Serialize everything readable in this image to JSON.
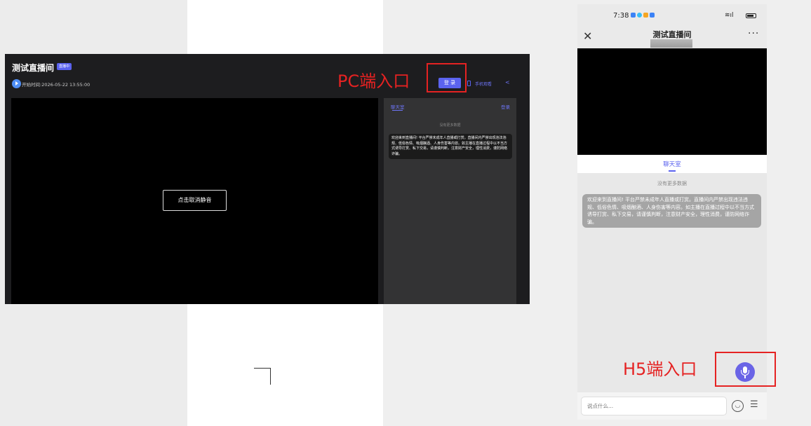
{
  "pc": {
    "title": "测试直播间",
    "live_badge": "直播中",
    "start_time": "开始时间:2026-05-22 13:55:00",
    "login_button": "登 录",
    "watch_on_phone": "手机观看",
    "share_icon": "share-icon",
    "unmute_button": "点击取消静音",
    "chat": {
      "tab": "聊天室",
      "login": "登录",
      "no_more": "没有更多数据",
      "welcome": "欢迎来到直播间! 平台严禁未成年人直播或打赏。直播间内严禁出现违法违规、低俗色情、吸烟酗酒、人身伤害等内容。如主播在直播过程中以不当方式诱导打赏、私下交易，请谨慎判断，注意财产安全，理性消费，谨防网络诈骗。"
    }
  },
  "annotations": {
    "pc_label": "PC端入口",
    "h5_label": "H5端入口",
    "color": "#e52222"
  },
  "phone": {
    "status_time": "7:38",
    "title": "测试直播间",
    "close_icon": "close-icon",
    "more_icon": "more-icon",
    "chat_tab": "聊天室",
    "no_more": "没有更多数据",
    "welcome": "欢迎来到直播间! 平台严禁未成年人直播或打赏。直播间内严禁出现违法违规、低俗色情、吸烟酗酒、人身伤害等内容。如主播在直播过程中以不当方式诱导打赏、私下交易，请谨慎判断，注意财产安全，理性消费，谨防网络诈骗。",
    "input_placeholder": "说点什么...",
    "mic_icon": "microphone-icon",
    "emoji_icon": "emoji-icon",
    "list_icon": "list-icon"
  },
  "colors": {
    "accent": "#5b63ef",
    "pc_bg": "#1d1d1f",
    "chat_bg": "#333334"
  }
}
